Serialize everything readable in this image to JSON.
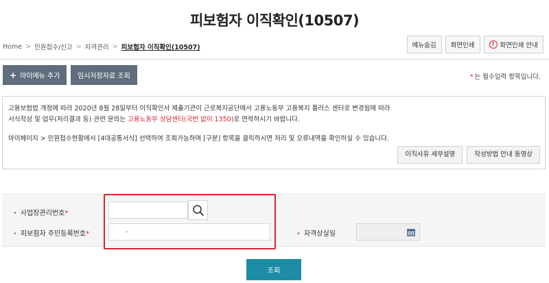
{
  "page": {
    "title": "피보험자 이직확인(10507)"
  },
  "breadcrumb": {
    "items": [
      "Home",
      "민원접수/신고",
      "자격관리"
    ],
    "current": "피보험자 이직확인(10507)",
    "separator": ">"
  },
  "toolbar": {
    "hide_menu": "메뉴숨김",
    "print": "화면인쇄",
    "print_guide": "화면인쇄 안내"
  },
  "actions": {
    "add_my_menu": "마이메뉴 추가",
    "add_icon": "+",
    "temp_saved": "임시저장자료 조회"
  },
  "required_note": {
    "star": "*",
    "text": "는 필수입력 항목입니다."
  },
  "info": {
    "line1": "고용보험법 개정에 따라 2020년 8월 28일부터 이직확인서 제출기관이 근로복지공단에서 고용노동부 고용복지 플러스 센터로 변경됨에 따라",
    "line2_prefix": "서식작성 및 업무(처리결과 등) 관련 문의는 ",
    "line2_highlight": "고용노동부 상담센터(국번 없이 1350)",
    "line2_suffix": "로 연락하시기 바랍니다.",
    "line3": "마이페이지 > 민원접수현황에서 [4대공통서식] 선택하여 조회가능하며 [구분] 항목을 클릭하시면 처리 및 오류내역을 확인하실 수 있습니다.",
    "btn_reason": "이직사유 세부설명",
    "btn_video": "작성방법 안내 동영상"
  },
  "form": {
    "business_no_label": "사업장관리번호",
    "business_no_value": "",
    "resident_no_label": "피보험자 주민등록번호",
    "resident_no_value": "-",
    "loss_date_label": "자격상실일",
    "loss_date_value": "",
    "bullet": "•",
    "required_star": "*"
  },
  "submit": {
    "label": "조회"
  },
  "colors": {
    "accent": "#1e8ca6",
    "required": "#d9232d",
    "action_button": "#5f6d7c",
    "highlight_border": "#d9232d"
  },
  "icons": {
    "search": "search-icon",
    "calendar": "calendar-icon",
    "alert": "alert-circle-icon"
  }
}
